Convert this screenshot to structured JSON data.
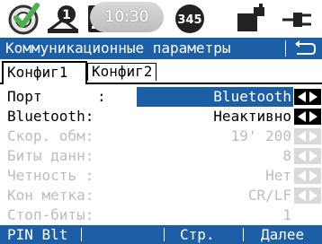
{
  "status": {
    "time": "10:30",
    "satellites": "345"
  },
  "title": "Коммуникационные параметры",
  "tabs": [
    "Конфиг1",
    "Конфиг2"
  ],
  "rows": [
    {
      "label": "Порт",
      "colon": ":",
      "value": "Bluetooth",
      "enabled": true,
      "selected": true
    },
    {
      "label": "Bluetooth:",
      "colon": "",
      "value": "Неактивно",
      "enabled": true,
      "selected": false
    },
    {
      "label": "Скор. обм:",
      "colon": "",
      "value": "19' 200",
      "enabled": false,
      "selected": false
    },
    {
      "label": "Биты данн:",
      "colon": "",
      "value": "8",
      "enabled": false,
      "selected": false
    },
    {
      "label": "Четность :",
      "colon": "",
      "value": "Нет",
      "enabled": false,
      "selected": false
    },
    {
      "label": "Кон метка:",
      "colon": "",
      "value": "CR/LF",
      "enabled": false,
      "selected": false
    },
    {
      "label": "Стоп-биты:",
      "colon": "",
      "value": "1",
      "enabled": false,
      "selected": false
    }
  ],
  "softkeys": {
    "f1": "PIN Blt",
    "f3": "Стр.",
    "f4": "Далее"
  },
  "colors": {
    "accent": "#1c5fa6",
    "disabled": "#bdbdbd"
  }
}
